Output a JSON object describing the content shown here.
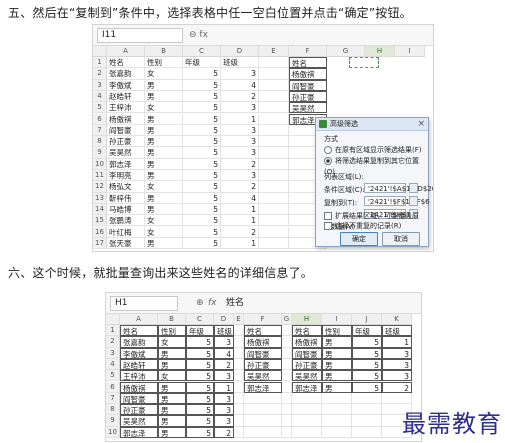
{
  "steps": {
    "five": "五、然后在“复制到”条件中，选择表格中任一空白位置并点击“确定”按钮。",
    "six": "六、这个时候，就批量查询出来这些姓名的详细信息了。"
  },
  "shot1": {
    "name_box": "I11",
    "formula": "",
    "columns": [
      "A",
      "B",
      "C",
      "D",
      "E",
      "F",
      "G",
      "H",
      "I"
    ],
    "selected_column": "H",
    "rows": [
      [
        "1",
        "姓名",
        "性别",
        "年级",
        "班级",
        "",
        "姓名"
      ],
      [
        "2",
        "张嘉韵",
        "女",
        "5",
        "3",
        "",
        "杨傲祺"
      ],
      [
        "3",
        "李傲斌",
        "男",
        "5",
        "4",
        "",
        "阎智豪"
      ],
      [
        "4",
        "赵皓轩",
        "男",
        "5",
        "2",
        "",
        "孙正豪"
      ],
      [
        "5",
        "王梓沛",
        "女",
        "5",
        "3",
        "",
        "吴昊然"
      ],
      [
        "6",
        "杨傲祺",
        "男",
        "5",
        "1",
        "",
        "郭志泽"
      ],
      [
        "7",
        "阎智豪",
        "男",
        "5",
        "3",
        "",
        ""
      ],
      [
        "8",
        "孙正豪",
        "男",
        "5",
        "3",
        "",
        ""
      ],
      [
        "9",
        "吴昊然",
        "男",
        "5",
        "3",
        "",
        ""
      ],
      [
        "10",
        "郭志泽",
        "男",
        "5",
        "2",
        "",
        ""
      ],
      [
        "11",
        "李明亮",
        "男",
        "5",
        "3",
        "",
        ""
      ],
      [
        "12",
        "杨弘文",
        "女",
        "5",
        "2",
        "",
        ""
      ],
      [
        "13",
        "靳梓伟",
        "男",
        "5",
        "4",
        "",
        ""
      ],
      [
        "14",
        "马皓博",
        "男",
        "5",
        "1",
        "",
        ""
      ],
      [
        "15",
        "张鹏涛",
        "女",
        "5",
        "1",
        "",
        ""
      ],
      [
        "16",
        "叶红梅",
        "女",
        "5",
        "2",
        "",
        ""
      ],
      [
        "17",
        "张天豪",
        "男",
        "5",
        "1",
        "",
        ""
      ]
    ]
  },
  "dialog": {
    "title": "高级筛选",
    "close": "×",
    "method_label": "方式",
    "option1": "在原有区域显示筛选结果(F)",
    "option2": "将筛选结果复制到其它位置(O)",
    "list_label": "列表区域(L):",
    "list_value": "'2421'!$A$1:$D$20",
    "criteria_label": "条件区域(C):",
    "criteria_value": "'2421'!$F$1:$F$6",
    "copy_label": "复制到(T):",
    "copy_value": "'2421'!$H$1",
    "extend_label": "扩展结果区域，可能覆盖原有数据(V)",
    "unique_label": "选择不重复的记录(R)",
    "ok": "确定",
    "cancel": "取消"
  },
  "shot2": {
    "name_box": "H1",
    "fx_label": "fx",
    "formula": "姓名",
    "columns": [
      "A",
      "B",
      "C",
      "D",
      "E",
      "F",
      "G",
      "H",
      "I",
      "J",
      "K"
    ],
    "selected_column": "H",
    "rows": [
      [
        "1",
        "姓名",
        "性别",
        "年级",
        "班级",
        "",
        "姓名",
        "",
        "姓名",
        "性别",
        "年级",
        "班级"
      ],
      [
        "2",
        "张嘉韵",
        "女",
        "5",
        "3",
        "",
        "杨傲祺",
        "",
        "杨傲祺",
        "男",
        "5",
        "1"
      ],
      [
        "3",
        "李傲斌",
        "男",
        "5",
        "4",
        "",
        "阎智豪",
        "",
        "阎智豪",
        "男",
        "5",
        "3"
      ],
      [
        "4",
        "赵皓轩",
        "男",
        "5",
        "2",
        "",
        "孙正豪",
        "",
        "孙正豪",
        "男",
        "5",
        "3"
      ],
      [
        "5",
        "王梓沛",
        "女",
        "5",
        "3",
        "",
        "吴昊然",
        "",
        "吴昊然",
        "男",
        "5",
        "3"
      ],
      [
        "6",
        "杨傲祺",
        "男",
        "5",
        "1",
        "",
        "郭志泽",
        "",
        "郭志泽",
        "男",
        "5",
        "2"
      ],
      [
        "7",
        "阎智豪",
        "男",
        "5",
        "3",
        "",
        "",
        "",
        "",
        "",
        "",
        ""
      ],
      [
        "8",
        "孙正豪",
        "男",
        "5",
        "3",
        "",
        "",
        "",
        "",
        "",
        "",
        ""
      ],
      [
        "9",
        "吴昊然",
        "男",
        "5",
        "3",
        "",
        "",
        "",
        "",
        "",
        "",
        ""
      ],
      [
        "10",
        "郭志泽",
        "男",
        "5",
        "2",
        "",
        "",
        "",
        "",
        "",
        "",
        ""
      ]
    ]
  },
  "watermark": "最需教育"
}
